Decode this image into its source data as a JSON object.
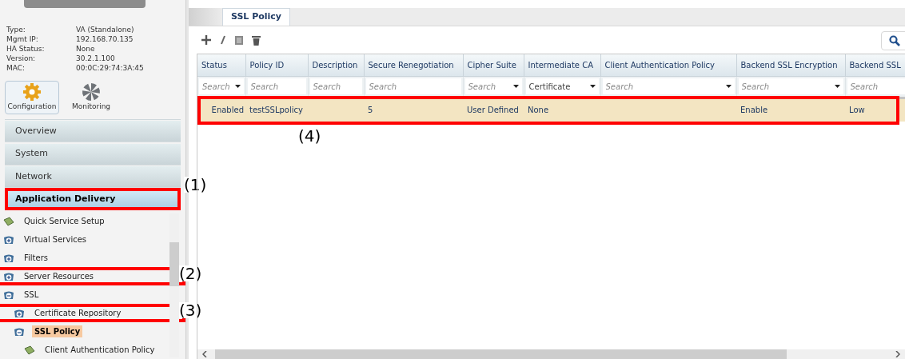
{
  "device_info": [
    {
      "label": "Type:",
      "value": "VA (Standalone)"
    },
    {
      "label": "Mgmt IP:",
      "value": "192.168.70.135"
    },
    {
      "label": "HA Status:",
      "value": "None"
    },
    {
      "label": "Version:",
      "value": "30.2.1.100"
    },
    {
      "label": "MAC:",
      "value": "00:0C:29:74:3A:45"
    }
  ],
  "modes": [
    {
      "label": "Configuration",
      "kind": "gear",
      "selected": true
    },
    {
      "label": "Monitoring",
      "kind": "pie",
      "selected": false
    }
  ],
  "nav": [
    {
      "label": "Overview",
      "selected": false
    },
    {
      "label": "System",
      "selected": false
    },
    {
      "label": "Network",
      "selected": false
    },
    {
      "label": "Application Delivery",
      "selected": true,
      "callout": "(1)"
    }
  ],
  "tree": [
    {
      "label": "Quick Service Setup",
      "kind": "page",
      "selected": false
    },
    {
      "label": "Virtual Services",
      "kind": "folder",
      "expanded": false,
      "selected": false
    },
    {
      "label": "Filters",
      "kind": "folder",
      "expanded": false,
      "selected": false
    },
    {
      "label": "Server Resources",
      "kind": "folder",
      "expanded": false,
      "selected": false,
      "callout": "(2)"
    },
    {
      "label": "SSL",
      "kind": "folder",
      "expanded": true,
      "selected": false,
      "children": [
        {
          "label": "Certificate Repository",
          "kind": "folder",
          "expanded": false,
          "selected": false,
          "callout": "(3)"
        },
        {
          "label": "SSL Policy",
          "kind": "folder",
          "expanded": true,
          "selected": true,
          "children": [
            {
              "label": "Client Authentication Policy",
              "kind": "page",
              "selected": false
            }
          ]
        }
      ]
    }
  ],
  "tabs": [
    {
      "label": "SSL Policy",
      "selected": true
    }
  ],
  "table": {
    "columns": [
      {
        "header": "Status",
        "placeholder": "Search",
        "dropdown": true
      },
      {
        "header": "Policy ID",
        "placeholder": "Search",
        "dropdown": false
      },
      {
        "header": "Description",
        "placeholder": "Search",
        "dropdown": false
      },
      {
        "header": "Secure Renegotiation",
        "placeholder": "Search",
        "dropdown": false
      },
      {
        "header": "Cipher Suite",
        "placeholder": "Search",
        "dropdown": true
      },
      {
        "header": "Intermediate CA",
        "value": "Certificate",
        "dropdown": true
      },
      {
        "header": "Client Authentication Policy",
        "placeholder": "Search",
        "dropdown": true
      },
      {
        "header": "Backend SSL Encryption",
        "placeholder": "Search",
        "dropdown": true
      },
      {
        "header": "Backend SSL",
        "placeholder": "Search",
        "dropdown": false
      }
    ],
    "rows": [
      {
        "selected": true,
        "callout": "(4)",
        "cells": [
          "Enabled",
          "testSSLpolicy",
          "",
          "5",
          "User Defined",
          "None",
          "",
          "Enable",
          "Low"
        ]
      }
    ]
  }
}
